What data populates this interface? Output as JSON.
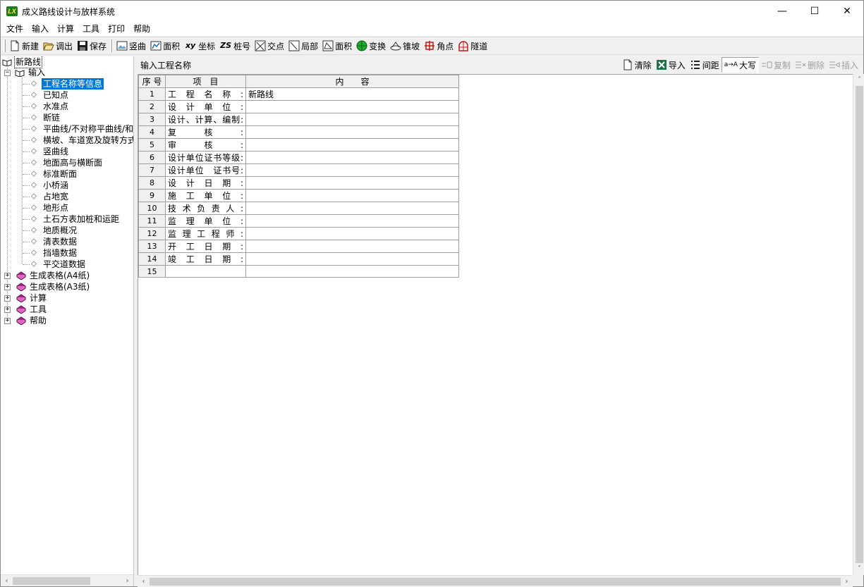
{
  "window": {
    "title": "成义路线设计与放样系统",
    "logo_text": "LX",
    "minimize": "—",
    "maximize": "☐",
    "close": "✕"
  },
  "menu": [
    "文件",
    "输入",
    "计算",
    "工具",
    "打印",
    "帮助"
  ],
  "toolbar": {
    "new": "新建",
    "load": "调出",
    "save": "保存",
    "vertical_curve": "竖曲",
    "area1": "面积",
    "coord_icon": "xy",
    "coord": "坐标",
    "station_icon": "ZS",
    "station": "桩号",
    "intersection": "交点",
    "local": "局部",
    "area2": "面积",
    "transform": "变换",
    "cone_slope": "锥坡",
    "corner": "角点",
    "tunnel": "隧道"
  },
  "tree": {
    "root": "新路线",
    "input": "输入",
    "input_children": [
      "工程名称等信息",
      "已知点",
      "水准点",
      "断链",
      "平曲线/不对称平曲线/和",
      "横坡、车道宽及旋转方式",
      "竖曲线",
      "地面高与横断面",
      "标准断面",
      "小桥涵",
      "占地宽",
      "地形点",
      "土石方表加桩和运距",
      "地质概况",
      "清表数据",
      "挡墙数据",
      "平交道数据"
    ],
    "groups": [
      "生成表格(A4纸)",
      "生成表格(A3纸)",
      "计算",
      "工具",
      "帮助"
    ],
    "expand_plus": "+",
    "expand_minus": "−"
  },
  "panel": {
    "title": "输入工程名称",
    "tools": {
      "clear": "清除",
      "import": "导入",
      "spacing": "间距",
      "uppercase_icon": "a→A",
      "uppercase": "大写",
      "copy": "复制",
      "delete": "删除",
      "insert": "插入"
    }
  },
  "table": {
    "headers": [
      "序 号",
      "项　目",
      "内　　容"
    ],
    "rows": [
      {
        "n": "1",
        "item": "工程名称:",
        "value": "新路线"
      },
      {
        "n": "2",
        "item": "设计单位:",
        "value": ""
      },
      {
        "n": "3",
        "item": "设计、计算、编制:",
        "value": ""
      },
      {
        "n": "4",
        "item": "复核:",
        "value": ""
      },
      {
        "n": "5",
        "item": "审核:",
        "value": ""
      },
      {
        "n": "6",
        "item": "设计单位证书等级:",
        "value": ""
      },
      {
        "n": "7",
        "item": "设计单位　证书号:",
        "value": ""
      },
      {
        "n": "8",
        "item": "设计日期:",
        "value": ""
      },
      {
        "n": "9",
        "item": "施工单位:",
        "value": ""
      },
      {
        "n": "10",
        "item": "技术负责人:",
        "value": ""
      },
      {
        "n": "11",
        "item": "监理单位:",
        "value": ""
      },
      {
        "n": "12",
        "item": "监理工程师:",
        "value": ""
      },
      {
        "n": "13",
        "item": "开工日期:",
        "value": ""
      },
      {
        "n": "14",
        "item": "竣工日期:",
        "value": ""
      },
      {
        "n": "15",
        "item": "",
        "value": ""
      }
    ]
  },
  "scroll": {
    "left": "‹",
    "right": "›",
    "up": "˄",
    "down": "˅"
  },
  "colors": {
    "selection": "#0078d7",
    "book": "#b0208f",
    "logo_bg": "#1f7a1f"
  }
}
